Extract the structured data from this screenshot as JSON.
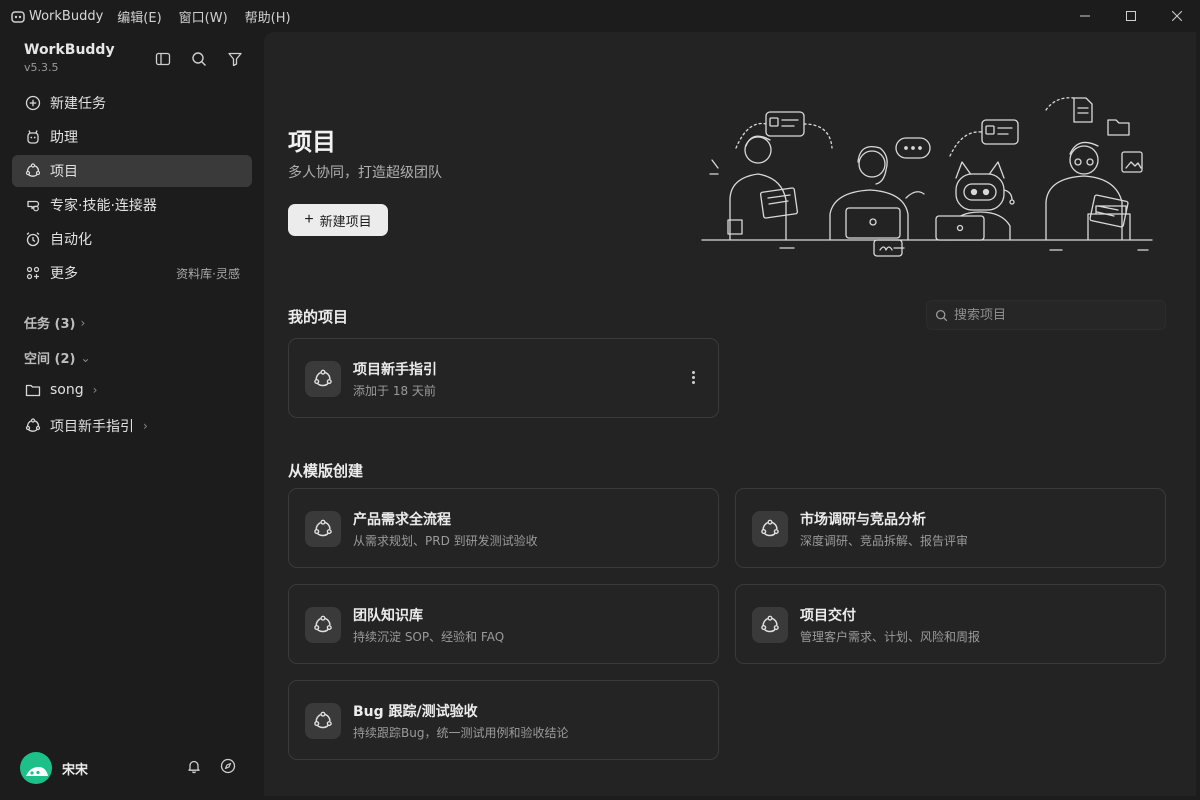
{
  "titlebar": {
    "app_name": "WorkBuddy",
    "menus": [
      "编辑(E)",
      "窗口(W)",
      "帮助(H)"
    ]
  },
  "sidebar": {
    "brand": "WorkBuddy",
    "version": "v5.3.5",
    "nav": [
      {
        "label": "新建任务",
        "icon": "plus-circle-icon"
      },
      {
        "label": "助理",
        "icon": "assistant-icon"
      },
      {
        "label": "项目",
        "icon": "project-icon",
        "active": true
      },
      {
        "label": "专家·技能·连接器",
        "icon": "expert-icon"
      },
      {
        "label": "自动化",
        "icon": "alarm-clock-icon"
      },
      {
        "label": "更多",
        "icon": "apps-icon",
        "extra": "资料库·灵感"
      }
    ],
    "tasks_label": "任务 (3)",
    "spaces_label": "空间 (2)",
    "spaces": [
      {
        "label": "song",
        "icon": "folder-icon"
      },
      {
        "label": "项目新手指引",
        "icon": "project-icon"
      }
    ],
    "user_name": "宋宋"
  },
  "main": {
    "title": "项目",
    "subtitle": "多人协同，打造超级团队",
    "new_button": "新建项目",
    "my_projects_heading": "我的项目",
    "search_placeholder": "搜索项目",
    "my_projects": [
      {
        "title": "项目新手指引",
        "desc": "添加于 18 天前"
      }
    ],
    "templates_heading": "从模版创建",
    "templates": [
      {
        "title": "产品需求全流程",
        "desc": "从需求规划、PRD 到研发测试验收"
      },
      {
        "title": "市场调研与竞品分析",
        "desc": "深度调研、竞品拆解、报告评审"
      },
      {
        "title": "团队知识库",
        "desc": "持续沉淀 SOP、经验和 FAQ"
      },
      {
        "title": "项目交付",
        "desc": "管理客户需求、计划、风险和周报"
      },
      {
        "title": "Bug 跟踪/测试验收",
        "desc": "持续跟踪Bug，统一测试用例和验收结论"
      }
    ]
  },
  "colors": {
    "accent_avatar": "#1ec08a",
    "active_nav": "#3a3a3a",
    "button_bg": "#ececec"
  }
}
